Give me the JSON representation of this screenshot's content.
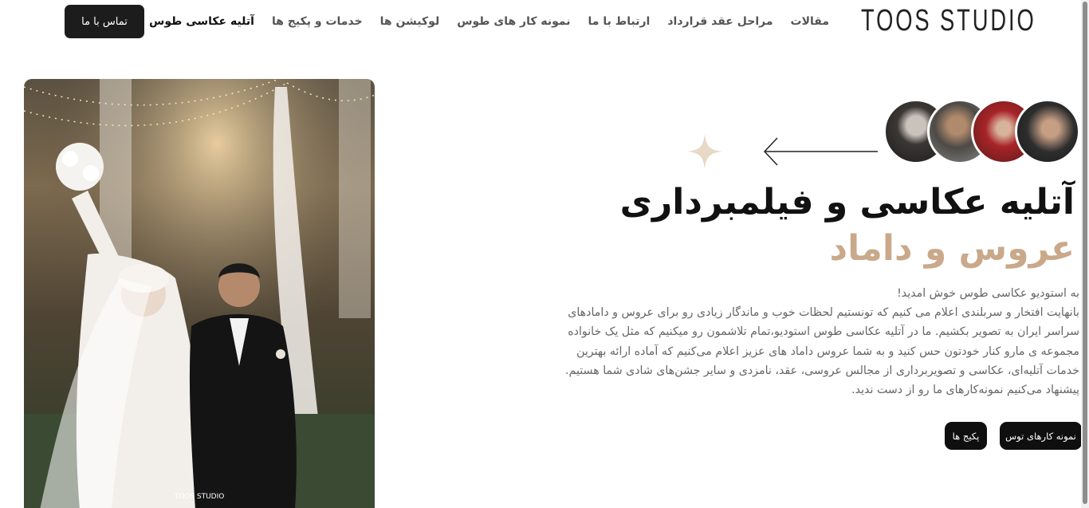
{
  "header": {
    "logo": "TOOS STUDIO",
    "nav": [
      {
        "label": "آتلیه عکاسی طوس استودیو",
        "active": true
      },
      {
        "label": "خدمات و پکیج ها"
      },
      {
        "label": "لوکیشن ها"
      },
      {
        "label": "نمونه کار های طوس"
      },
      {
        "label": "ارتباط با ما"
      },
      {
        "label": "مراحل عقد قرارداد"
      },
      {
        "label": "مقالات"
      }
    ],
    "contact_button": "تماس با ما"
  },
  "hero": {
    "photo_watermark": "TOOS STUDIO",
    "title_line1": "آتلیه عکاسی و فیلمبرداری",
    "title_line2": "عروس و داماد",
    "intro_lines": [
      "به استودیو عکاسی طوس خوش امدید!",
      "بانهایت افتخار و سربلندی اعلام می کنیم که تونستیم لحظات خوب و ماندگار زیادی رو برای عروس و دامادهای",
      "سراسر ایران به تصویر بکشیم. ما در آتلیه عکاسی طوس استودیو،تمام تلاشمون رو میکنیم که مثل یک خانواده",
      "مجموعه ی مارو کنار خودتون حس کنید و به شما عروس داماد های عزیز اعلام می‌کنیم که آماده ارائه بهترین",
      "خدمات آتلیه‌ای، عکاسی و تصویربرداری از مجالس عروسی، عقد، نامزدی و سایر جشن‌های شادی شما هستیم.",
      "پیشنهاد می‌کنیم نمونه‌کارهای ما رو از دست ندید."
    ],
    "buttons": {
      "works": "نمونه کارهای توس",
      "packages": "پکیج ها"
    }
  },
  "colors": {
    "accent": "#c9a98a",
    "dark": "#1c1c1c"
  }
}
